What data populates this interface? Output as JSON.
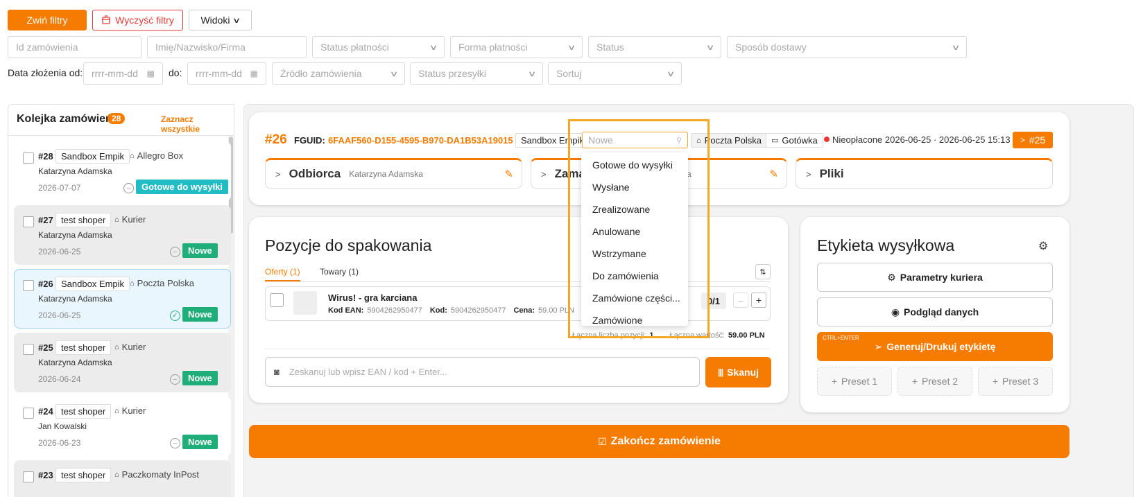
{
  "toolbar": {
    "collapse_filters": "Zwiń filtry",
    "clear_filters": "Wyczyść filtry",
    "views": "Widoki"
  },
  "filters": {
    "order_id_placeholder": "Id zamówienia",
    "name_placeholder": "Imię/Nazwisko/Firma",
    "payment_status": "Status płatności",
    "payment_method": "Forma płatności",
    "status": "Status",
    "delivery_method": "Sposób dostawy",
    "date_from_label": "Data złożenia od:",
    "date_from_placeholder": "rrrr-mm-dd",
    "date_to_label": "do:",
    "date_to_placeholder": "rrrr-mm-dd",
    "order_source": "Źródło zamówienia",
    "shipment_status": "Status przesyłki",
    "sort": "Sortuj"
  },
  "queue": {
    "title": "Kolejka zamówień",
    "count": "28",
    "select_all": "Zaznacz wszystkie",
    "orders": [
      {
        "id": "#28",
        "shop": "Sandbox Empik",
        "delivery": "Allegro Box",
        "customer": "Katarzyna Adamska",
        "date": "2026-07-07",
        "status": "Gotowe do wysyłki"
      },
      {
        "id": "#27",
        "shop": "test shoper",
        "delivery": "Kurier",
        "customer": "Katarzyna Adamska",
        "date": "2026-06-25",
        "status": "Nowe"
      },
      {
        "id": "#26",
        "shop": "Sandbox Empik",
        "delivery": "Poczta Polska",
        "customer": "Katarzyna Adamska",
        "date": "2026-06-25",
        "status": "Nowe"
      },
      {
        "id": "#25",
        "shop": "test shoper",
        "delivery": "Kurier",
        "customer": "Katarzyna Adamska",
        "date": "2026-06-24",
        "status": "Nowe"
      },
      {
        "id": "#24",
        "shop": "test shoper",
        "delivery": "Kurier",
        "customer": "Jan Kowalski",
        "date": "2026-06-23",
        "status": "Nowe"
      },
      {
        "id": "#23",
        "shop": "test shoper",
        "delivery": "Paczkomaty InPost",
        "customer": "",
        "date": "",
        "status": ""
      }
    ]
  },
  "order": {
    "number": "#26",
    "fguid_label": "FGUID:",
    "fguid": "6FAAF560-D155-4595-B970-DA1B53A19015",
    "shop": "Sandbox Empik",
    "status_placeholder": "Nowe",
    "delivery": "Poczta Polska",
    "payment": "Gotówka",
    "payment_status_dates": "Nieopłacone 2026-06-25 · 2026-06-25 15:13",
    "next_order": "#25"
  },
  "sections": {
    "recipient": "Odbiorca",
    "recipient_name": "Katarzyna Adamska",
    "order_partial": "Zama",
    "order_sub_partial": "a",
    "files": "Pliki"
  },
  "status_menu": [
    "Gotowe do wysyłki",
    "Wysłane",
    "Zrealizowane",
    "Anulowane",
    "Wstrzymane",
    "Do zamówienia",
    "Zamówione części...",
    "Zamówione"
  ],
  "packing": {
    "title": "Pozycje do spakowania",
    "tab_offers": "Oferty (1)",
    "tab_products": "Towary (1)",
    "item_name": "Wirus! - gra karciana",
    "ean_label": "Kod EAN:",
    "ean": "5904262950477",
    "code_label": "Kod:",
    "code": "5904262950477",
    "price_label": "Cena:",
    "price": "59.00 PLN",
    "qty": "0/1",
    "total_count_label": "Łączna liczba pozycji:",
    "total_count": "1",
    "total_value_label": "Łączna wartość:",
    "total_value": "59.00 PLN",
    "scan_placeholder": "Zeskanuj lub wpisz EAN / kod + Enter...",
    "scan_button": "Skanuj"
  },
  "label": {
    "title": "Etykieta wysyłkowa",
    "courier_params": "Parametry kuriera",
    "preview": "Podgląd danych",
    "shortcut": "CTRL+ENTER",
    "generate": "Generuj/Drukuj etykietę",
    "preset1": "Preset 1",
    "preset2": "Preset 2",
    "preset3": "Preset 3"
  },
  "finish_button": "Zakończ zamówienie",
  "colors": {
    "accent": "#f57c00",
    "teal": "#22bdc4",
    "green": "#1fae7a",
    "red": "#e53935",
    "highlight": "#f5a623"
  }
}
